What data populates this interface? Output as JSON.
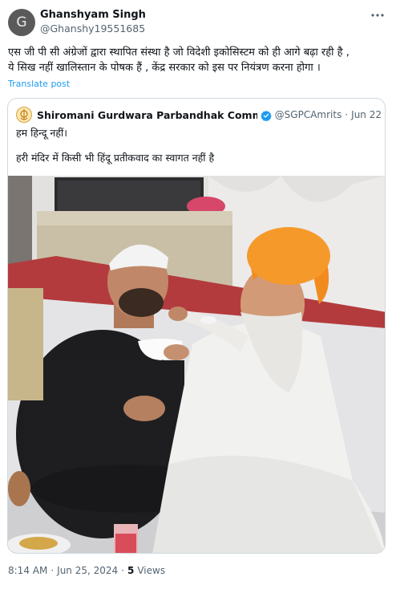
{
  "author": {
    "avatar_letter": "G",
    "name": "Ghanshyam Singh",
    "handle": "@Ghanshy19551685"
  },
  "post": {
    "text_line1": "एस जी पी सी अंग्रेजों द्वारा स्थापित संस्था है जो विदेशी इकोसिस्टम को ही आगे बढ़ा रही है ,",
    "text_line2": "ये सिख नहीं खालिस्तान के पोषक हैं , केंद्र सरकार को इस पर नियंत्रण करना होगा ।",
    "translate_label": "Translate post"
  },
  "quoted": {
    "name": "Shiromani Gurdwara Parbandhak Committee I",
    "handle": "@SGPCAmrits",
    "date": "Jun 22",
    "line1": "हम हिन्दू नहीं।",
    "line2": "हरी मंदिर में किसी भी हिंदू प्रतीकवाद का स्वागत नहीं है"
  },
  "meta": {
    "time": "8:14 AM",
    "date": "Jun 25, 2024",
    "views_count": "5",
    "views_label": "Views"
  },
  "colors": {
    "link": "#1d9bf0",
    "muted": "#536471",
    "verified": "#1d9bf0"
  },
  "icons": {
    "more": "more-horizontal-icon",
    "verified": "verified-badge-icon"
  }
}
